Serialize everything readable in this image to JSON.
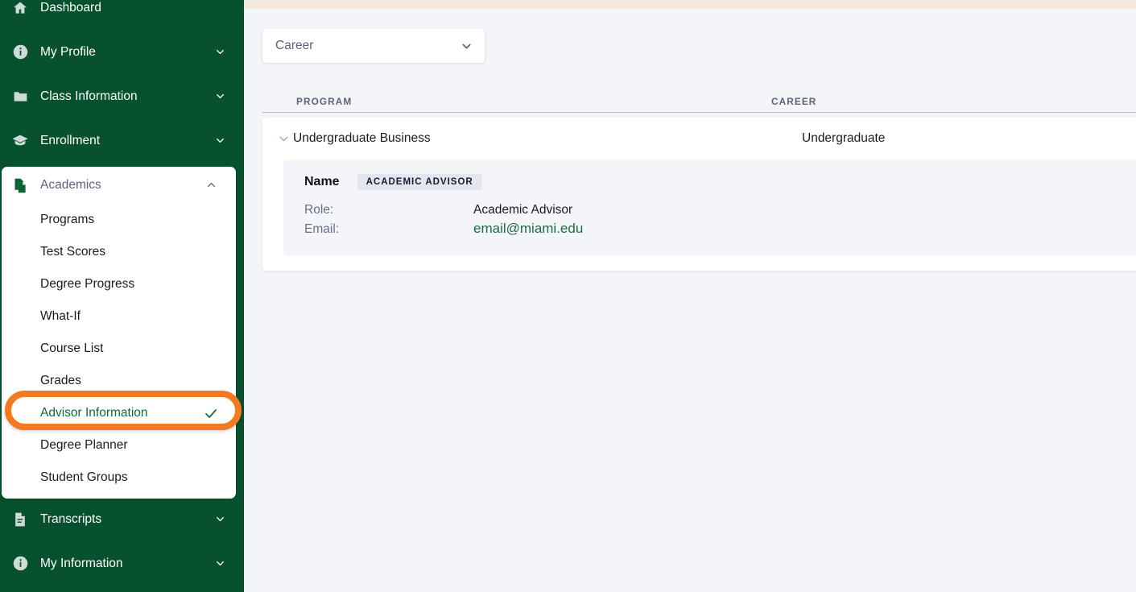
{
  "colors": {
    "sidebar_green": "#07512E",
    "highlight_orange": "#F47A21",
    "accent_green": "#0D6B38",
    "email_green": "#1D6A45",
    "page_bg": "#F4F5F9",
    "top_band": "#F2E8DC",
    "badge_bg": "#E3E5EF"
  },
  "sidebar": {
    "top_items": [
      {
        "label": "Dashboard",
        "icon": "home-icon",
        "chevron": false
      },
      {
        "label": "My Profile",
        "icon": "info-circle-icon",
        "chevron": true
      },
      {
        "label": "Class Information",
        "icon": "folder-icon",
        "chevron": true
      },
      {
        "label": "Enrollment",
        "icon": "graduation-cap-icon",
        "chevron": true
      }
    ],
    "group": {
      "label": "Academics",
      "icon": "documents-copy-icon",
      "chevron": "chevron-up-icon",
      "expanded": true,
      "items": [
        {
          "label": "Programs",
          "active": false
        },
        {
          "label": "Test Scores",
          "active": false
        },
        {
          "label": "Degree Progress",
          "active": false
        },
        {
          "label": "What-If",
          "active": false
        },
        {
          "label": "Course List",
          "active": false
        },
        {
          "label": "Grades",
          "active": false
        },
        {
          "label": "Advisor Information",
          "active": true
        },
        {
          "label": "Degree Planner",
          "active": false
        },
        {
          "label": "Student Groups",
          "active": false
        }
      ]
    },
    "bottom_items": [
      {
        "label": "Transcripts",
        "icon": "document-lines-icon",
        "chevron": true
      },
      {
        "label": "My Information",
        "icon": "info-circle-icon",
        "chevron": true
      }
    ]
  },
  "main": {
    "career_select": {
      "value": "Career",
      "placeholder": "Career",
      "chevron": "chevron-down-icon"
    },
    "table": {
      "columns": [
        "PROGRAM",
        "CAREER"
      ],
      "rows": [
        {
          "program": "Undergraduate Business",
          "career": "Undergraduate",
          "expanded": true,
          "advisor": {
            "name": "Name",
            "badge": "ACADEMIC ADVISOR",
            "fields": [
              {
                "key": "Role:",
                "value": "Academic Advisor",
                "type": "text"
              },
              {
                "key": "Email:",
                "value": "email@miami.edu",
                "type": "email"
              }
            ]
          }
        }
      ]
    }
  }
}
